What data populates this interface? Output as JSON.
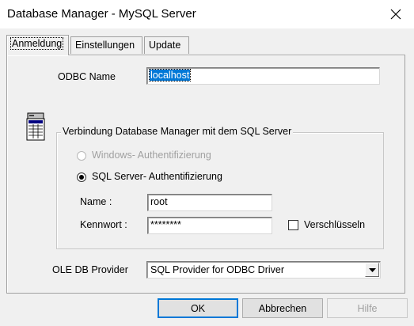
{
  "window": {
    "title": "Database Manager - MySQL Server"
  },
  "tabs": [
    {
      "label": "Anmeldung",
      "active": true
    },
    {
      "label": "Einstellungen",
      "active": false
    },
    {
      "label": "Update",
      "active": false
    }
  ],
  "odbc": {
    "label": "ODBC Name",
    "value": "localhost"
  },
  "connection_group": {
    "title": "Verbindung Database Manager mit dem SQL Server",
    "radio_windows": {
      "label": "Windows- Authentifizierung",
      "enabled": false,
      "checked": false
    },
    "radio_sql": {
      "label": "SQL Server- Authentifizierung",
      "enabled": true,
      "checked": true
    },
    "name_label": "Name :",
    "name_value": "root",
    "password_label": "Kennwort :",
    "password_value": "********",
    "encrypt_label": "Verschlüsseln",
    "encrypt_checked": false
  },
  "provider": {
    "label": "OLE DB Provider",
    "selected": "SQL Provider for ODBC Driver"
  },
  "buttons": {
    "ok": "OK",
    "cancel": "Abbrechen",
    "help": "Hilfe"
  },
  "icons": {
    "database": "database-icon",
    "close": "close-icon",
    "dropdown": "dropdown-arrow-icon"
  }
}
